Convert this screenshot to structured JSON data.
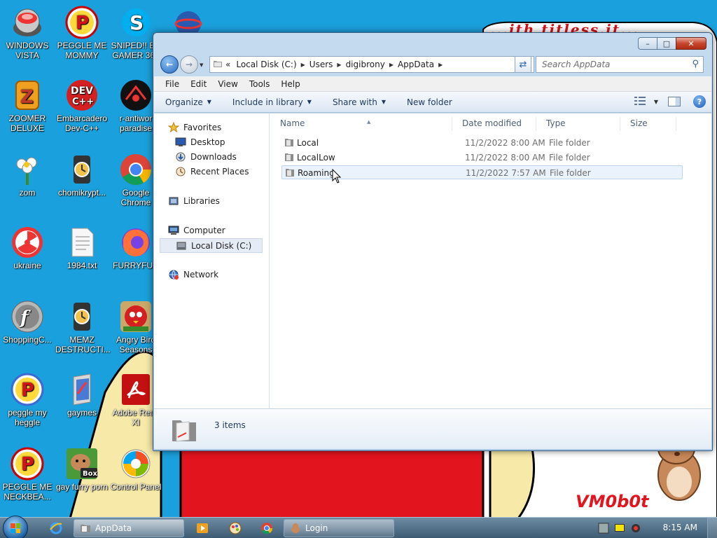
{
  "desktop": {
    "wallpaper_text": "...ith   titless.it...",
    "wallpaper_logo": "VM0b0t",
    "icons": [
      {
        "label": "WINDOWS VISTA",
        "icon": "windows-vista-orb-icon"
      },
      {
        "label": "PEGGLE ME MOMMY",
        "icon": "peggle-icon"
      },
      {
        "label": "SNIPED!! EP GAMER 360",
        "icon": "skype-icon"
      },
      {
        "label": "ZOOMER DELUXE",
        "icon": "zoomer-icon"
      },
      {
        "label": "Embarcadero Dev-C++",
        "icon": "devcpp-icon"
      },
      {
        "label": "r-antiwor paradise",
        "icon": "antiworm-icon"
      },
      {
        "label": "zom",
        "icon": "zom-flower-icon"
      },
      {
        "label": "chomikrypt...",
        "icon": "hourglass-icon"
      },
      {
        "label": "Google Chrome",
        "icon": "chrome-icon"
      },
      {
        "label": "ukraine",
        "icon": "radiation-icon"
      },
      {
        "label": "1984.txt",
        "icon": "text-file-icon"
      },
      {
        "label": "FURRYFUC",
        "icon": "firefox-icon"
      },
      {
        "label": "ShoppingC...",
        "icon": "flash-icon"
      },
      {
        "label": "MEMZ DESTRUCTI...",
        "icon": "hourglass-icon"
      },
      {
        "label": "Angry Bird Seasons",
        "icon": "angry-birds-icon"
      },
      {
        "label": "peggle my heggle",
        "icon": "peggle-icon"
      },
      {
        "label": "gaymes",
        "icon": "games-folder-icon"
      },
      {
        "label": "Adobe Read XI",
        "icon": "adobe-reader-icon"
      },
      {
        "label": "PEGGLE ME NECKBEA...",
        "icon": "peggle-icon"
      },
      {
        "label": "gay furry porn",
        "icon": "box-hamster-icon"
      },
      {
        "label": "Control Panel",
        "icon": "control-panel-icon"
      }
    ]
  },
  "window": {
    "title": "AppData",
    "caption": {
      "minimize": "–",
      "maximize": "□",
      "close": "✕"
    },
    "address": {
      "overflow": "«",
      "crumbs": [
        "Local Disk (C:)",
        "Users",
        "digibrony",
        "AppData"
      ]
    },
    "search_placeholder": "Search AppData",
    "menu": [
      "File",
      "Edit",
      "View",
      "Tools",
      "Help"
    ],
    "commands": {
      "organize": "Organize",
      "include": "Include in library",
      "share": "Share with",
      "new_folder": "New folder"
    },
    "nav": {
      "favorites": "Favorites",
      "desktop": "Desktop",
      "downloads": "Downloads",
      "recent": "Recent Places",
      "libraries": "Libraries",
      "computer": "Computer",
      "local_disk": "Local Disk (C:)",
      "network": "Network"
    },
    "columns": {
      "name": "Name",
      "date": "Date modified",
      "type": "Type",
      "size": "Size"
    },
    "files": [
      {
        "name": "Local",
        "date": "11/2/2022 8:00 AM",
        "type": "File folder",
        "size": ""
      },
      {
        "name": "LocalLow",
        "date": "11/2/2022 8:00 AM",
        "type": "File folder",
        "size": ""
      },
      {
        "name": "Roaming",
        "date": "11/2/2022 7:57 AM",
        "type": "File folder",
        "size": ""
      }
    ],
    "selected_row": 2,
    "status": "3 items"
  },
  "taskbar": {
    "buttons": [
      {
        "label": "AppData",
        "icon": "explorer-folder-icon",
        "active": true
      },
      {
        "label": "Login",
        "icon": "login-app-icon",
        "active": false
      }
    ],
    "clock": "8:15 AM"
  },
  "colors": {
    "desktop_bg": "#1aa0dc",
    "selection": "#eaf2fc",
    "wall_red": "#e2141d"
  }
}
